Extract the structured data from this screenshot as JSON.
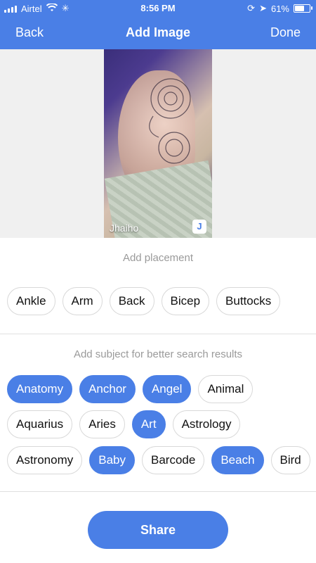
{
  "status": {
    "carrier": "Airtel",
    "time": "8:56 PM",
    "battery": "61%",
    "battery_level": 0.61
  },
  "nav": {
    "back": "Back",
    "title": "Add Image",
    "done": "Done"
  },
  "preview": {
    "caption": "Jhaiho",
    "logo": "J"
  },
  "placement": {
    "label": "Add placement",
    "chips": [
      "Ankle",
      "Arm",
      "Back",
      "Bicep",
      "Buttocks"
    ]
  },
  "subject": {
    "label": "Add subject for better search results",
    "row1": [
      {
        "text": "Anatomy",
        "selected": true
      },
      {
        "text": "Anchor",
        "selected": true
      },
      {
        "text": "Angel",
        "selected": true
      },
      {
        "text": "Animal",
        "selected": false
      }
    ],
    "row2": [
      {
        "text": "Aquarius",
        "selected": false
      },
      {
        "text": "Aries",
        "selected": false
      },
      {
        "text": "Art",
        "selected": true
      },
      {
        "text": "Astrology",
        "selected": false
      }
    ],
    "row3": [
      {
        "text": "Astronomy",
        "selected": false
      },
      {
        "text": "Baby",
        "selected": true
      },
      {
        "text": "Barcode",
        "selected": false
      },
      {
        "text": "Beach",
        "selected": true
      },
      {
        "text": "Bird",
        "selected": false
      }
    ]
  },
  "actions": {
    "share": "Share"
  },
  "colors": {
    "accent": "#4a7fe6"
  }
}
